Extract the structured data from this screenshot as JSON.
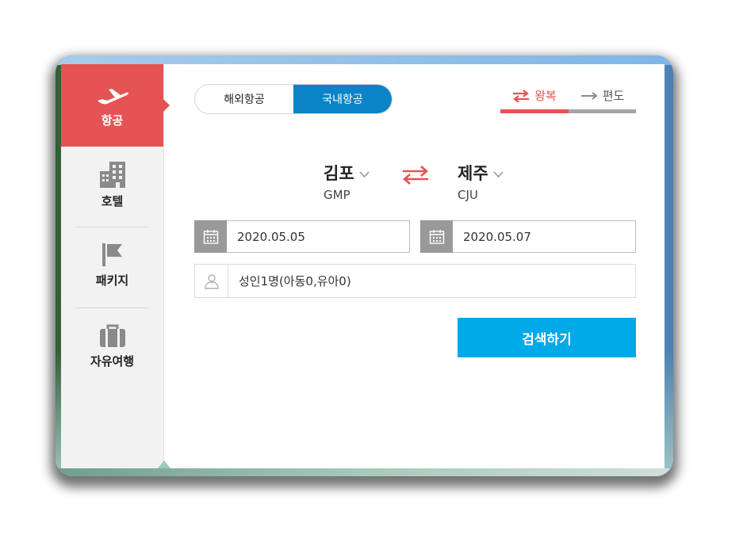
{
  "sidebar": {
    "items": [
      {
        "label": "항공",
        "icon": "airplane-icon",
        "active": true
      },
      {
        "label": "호텔",
        "icon": "building-icon"
      },
      {
        "label": "패키지",
        "icon": "flag-icon"
      },
      {
        "label": "자유여행",
        "icon": "suitcase-icon"
      }
    ]
  },
  "tabs": {
    "international": "해외항공",
    "domestic": "국내항공",
    "active": "domestic"
  },
  "trip_type": {
    "round_trip": "왕복",
    "one_way": "편도",
    "selected": "round_trip"
  },
  "route": {
    "departure": {
      "city": "김포",
      "code": "GMP"
    },
    "arrival": {
      "city": "제주",
      "code": "CJU"
    }
  },
  "dates": {
    "departure": "2020.05.05",
    "return": "2020.05.07"
  },
  "passengers": "성인1명(아동0,유아0)",
  "search_button": "검색하기",
  "colors": {
    "accent_red": "#e55454",
    "tab_blue": "#0a84c6",
    "search_blue": "#00a9e8"
  }
}
